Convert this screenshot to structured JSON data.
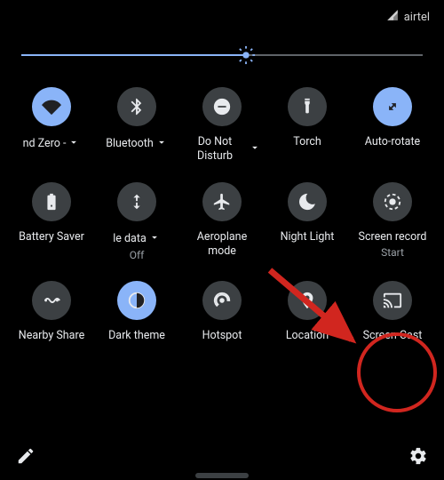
{
  "status": {
    "carrier": "airtel"
  },
  "brightness": {
    "percent": 56
  },
  "tiles": [
    {
      "id": "wifi",
      "label": "nd Zero -",
      "on": true,
      "dropdown": true
    },
    {
      "id": "bluetooth",
      "label": "Bluetooth",
      "on": false,
      "dropdown": true
    },
    {
      "id": "dnd",
      "label": "Do Not Disturb",
      "on": false,
      "dropdown": true
    },
    {
      "id": "torch",
      "label": "Torch",
      "on": false
    },
    {
      "id": "autorotate",
      "label": "Auto-rotate",
      "on": true
    },
    {
      "id": "battery",
      "label": "Battery Saver",
      "on": false
    },
    {
      "id": "mobiledata",
      "label": "le data",
      "sub": "Off",
      "on": false,
      "dropdown": true
    },
    {
      "id": "airplane",
      "label": "Aeroplane mode",
      "on": false
    },
    {
      "id": "nightlight",
      "label": "Night Light",
      "on": false
    },
    {
      "id": "screenrecord",
      "label": "Screen record",
      "sub": "Start",
      "on": false
    },
    {
      "id": "nearby",
      "label": "Nearby Share",
      "on": false
    },
    {
      "id": "darktheme",
      "label": "Dark theme",
      "on": true
    },
    {
      "id": "hotspot",
      "label": "Hotspot",
      "on": false
    },
    {
      "id": "location",
      "label": "Location",
      "on": false
    },
    {
      "id": "cast",
      "label": "Screen Cast",
      "on": false
    }
  ],
  "annotation": {
    "highlight_tile": "cast",
    "color": "#d1261f"
  }
}
